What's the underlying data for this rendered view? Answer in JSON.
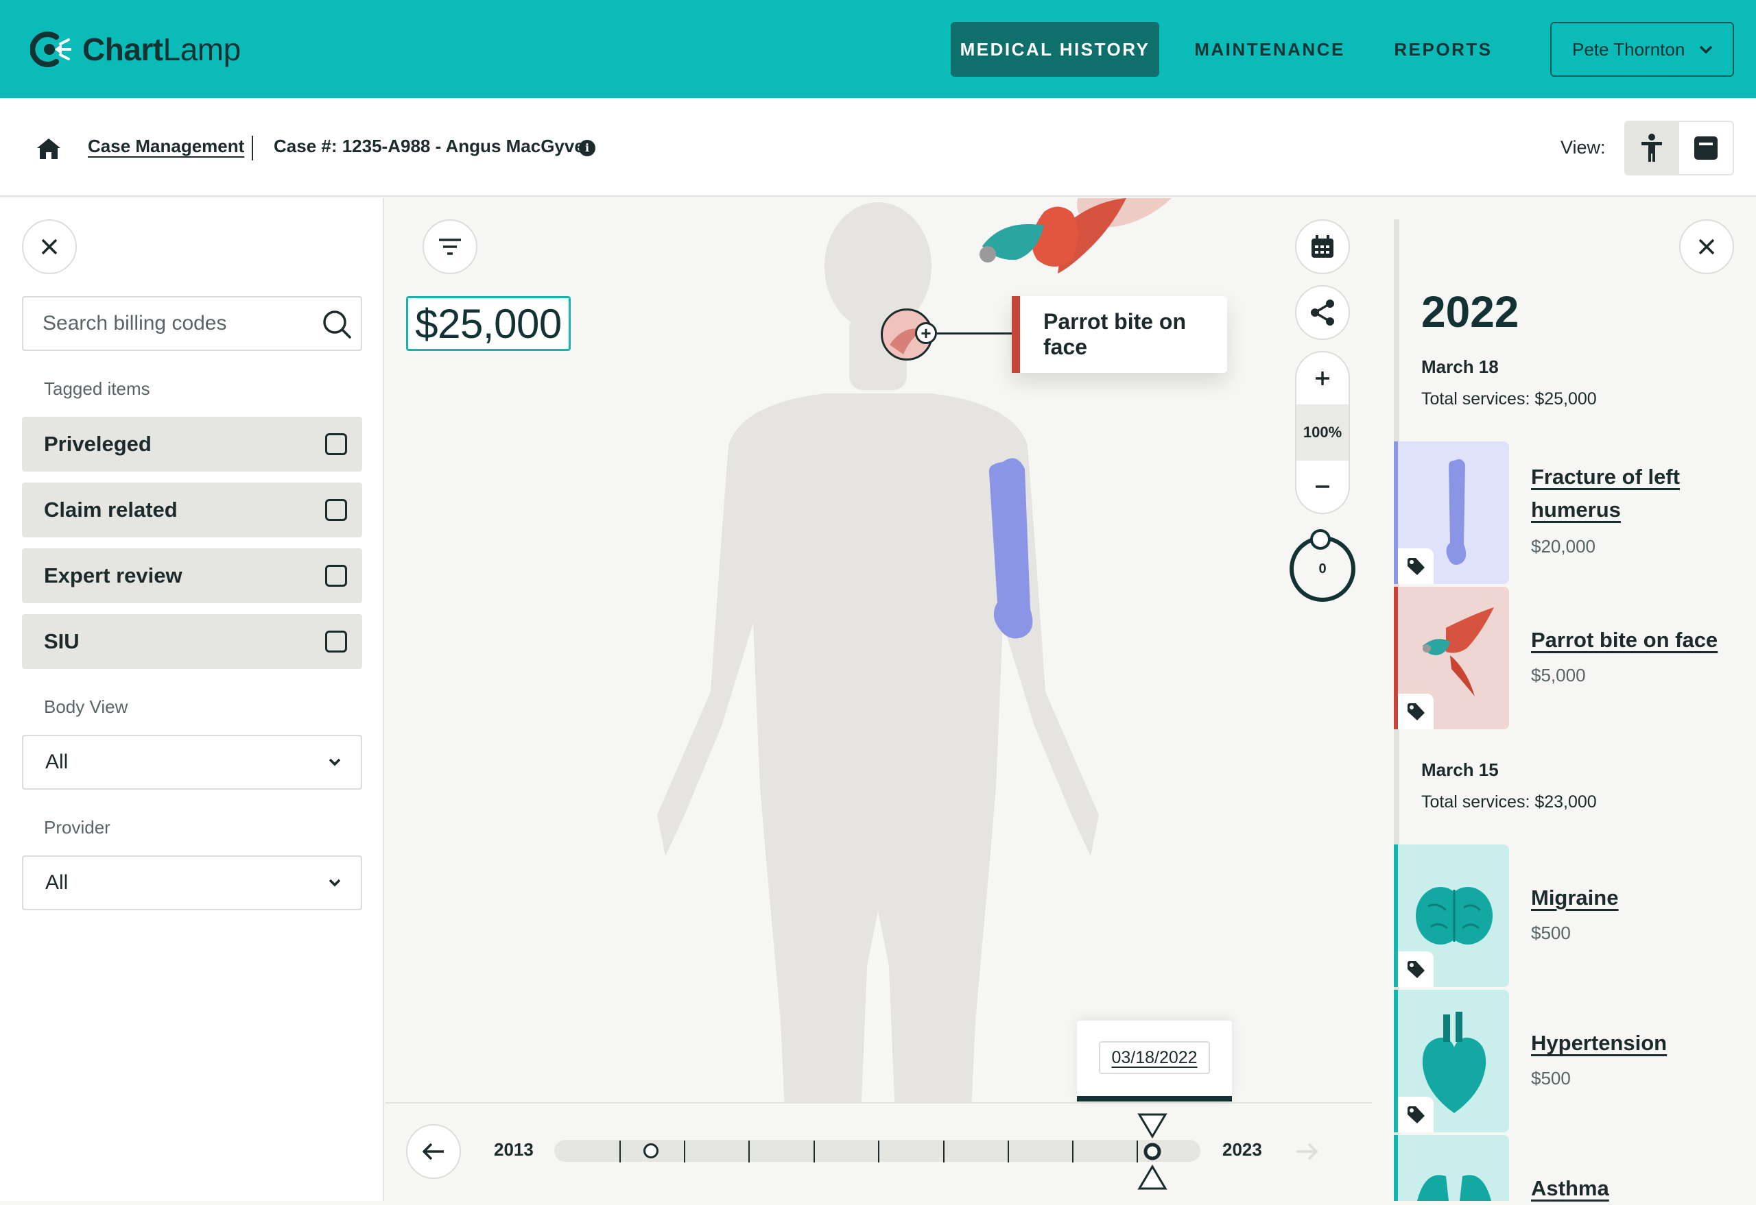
{
  "app": {
    "brand_part1": "Chart",
    "brand_part2": "Lamp",
    "brand_color": "#0bbbb7",
    "accent_dark": "#0f6f6c",
    "nav_tabs": [
      {
        "label": "MEDICAL HISTORY",
        "active": true
      },
      {
        "label": "MAINTENANCE",
        "active": false
      },
      {
        "label": "REPORTS",
        "active": false
      }
    ],
    "user_name": "Pete Thornton"
  },
  "breadcrumb": {
    "link": "Case Management",
    "case_label": "Case #: 1235-A988 - Angus MacGyver",
    "view_label": "View:",
    "view_options": [
      "body-icon",
      "list-icon"
    ]
  },
  "filters": {
    "search_placeholder": "Search billing codes",
    "tagged_label": "Tagged items",
    "tags": [
      {
        "label": "Priveleged",
        "checked": false
      },
      {
        "label": "Claim related",
        "checked": false
      },
      {
        "label": "Expert review",
        "checked": false
      },
      {
        "label": "SIU",
        "checked": false
      }
    ],
    "body_view_label": "Body View",
    "body_view_value": "All",
    "provider_label": "Provider",
    "provider_value": "All"
  },
  "canvas": {
    "total_amount": "$25,000",
    "callout_label": "Parrot bite on face",
    "callout_color": "#c64536",
    "zoom_level": "100%",
    "dial_value": "0",
    "timeline": {
      "start_year": "2013",
      "end_year": "2023",
      "selected_date": "03/18/2022"
    }
  },
  "history": {
    "year": "2022",
    "groups": [
      {
        "date": "March 18",
        "total": "Total services: $25,000",
        "items": [
          {
            "title": "Fracture of left humerus",
            "cost": "$20,000",
            "color": "#8b95e6",
            "bg": "#dfe2fa",
            "icon": "bone-icon"
          },
          {
            "title": "Parrot bite on face",
            "cost": "$5,000",
            "color": "#c64536",
            "bg": "#f0d6d2",
            "icon": "parrot-icon"
          }
        ]
      },
      {
        "date": "March 15",
        "total": "Total services: $23,000",
        "items": [
          {
            "title": "Migraine",
            "cost": "$500",
            "color": "#14b5b0",
            "bg": "#c9eeec",
            "icon": "brain-icon"
          },
          {
            "title": "Hypertension",
            "cost": "$500",
            "color": "#14b5b0",
            "bg": "#c9eeec",
            "icon": "heart-icon"
          },
          {
            "title": "Asthma",
            "color": "#14b5b0",
            "bg": "#c9eeec",
            "icon": "lungs-icon"
          }
        ]
      }
    ]
  }
}
